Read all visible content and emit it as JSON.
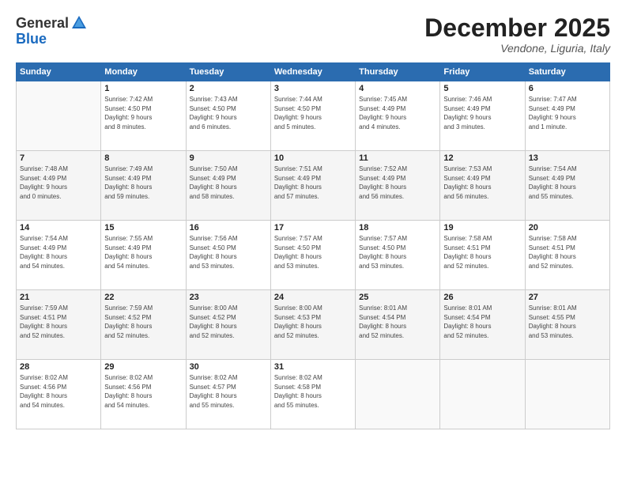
{
  "header": {
    "logo_general": "General",
    "logo_blue": "Blue",
    "month_title": "December 2025",
    "location": "Vendone, Liguria, Italy"
  },
  "weekdays": [
    "Sunday",
    "Monday",
    "Tuesday",
    "Wednesday",
    "Thursday",
    "Friday",
    "Saturday"
  ],
  "rows": [
    [
      {
        "day": "",
        "info": ""
      },
      {
        "day": "1",
        "info": "Sunrise: 7:42 AM\nSunset: 4:50 PM\nDaylight: 9 hours\nand 8 minutes."
      },
      {
        "day": "2",
        "info": "Sunrise: 7:43 AM\nSunset: 4:50 PM\nDaylight: 9 hours\nand 6 minutes."
      },
      {
        "day": "3",
        "info": "Sunrise: 7:44 AM\nSunset: 4:50 PM\nDaylight: 9 hours\nand 5 minutes."
      },
      {
        "day": "4",
        "info": "Sunrise: 7:45 AM\nSunset: 4:49 PM\nDaylight: 9 hours\nand 4 minutes."
      },
      {
        "day": "5",
        "info": "Sunrise: 7:46 AM\nSunset: 4:49 PM\nDaylight: 9 hours\nand 3 minutes."
      },
      {
        "day": "6",
        "info": "Sunrise: 7:47 AM\nSunset: 4:49 PM\nDaylight: 9 hours\nand 1 minute."
      }
    ],
    [
      {
        "day": "7",
        "info": "Sunrise: 7:48 AM\nSunset: 4:49 PM\nDaylight: 9 hours\nand 0 minutes."
      },
      {
        "day": "8",
        "info": "Sunrise: 7:49 AM\nSunset: 4:49 PM\nDaylight: 8 hours\nand 59 minutes."
      },
      {
        "day": "9",
        "info": "Sunrise: 7:50 AM\nSunset: 4:49 PM\nDaylight: 8 hours\nand 58 minutes."
      },
      {
        "day": "10",
        "info": "Sunrise: 7:51 AM\nSunset: 4:49 PM\nDaylight: 8 hours\nand 57 minutes."
      },
      {
        "day": "11",
        "info": "Sunrise: 7:52 AM\nSunset: 4:49 PM\nDaylight: 8 hours\nand 56 minutes."
      },
      {
        "day": "12",
        "info": "Sunrise: 7:53 AM\nSunset: 4:49 PM\nDaylight: 8 hours\nand 56 minutes."
      },
      {
        "day": "13",
        "info": "Sunrise: 7:54 AM\nSunset: 4:49 PM\nDaylight: 8 hours\nand 55 minutes."
      }
    ],
    [
      {
        "day": "14",
        "info": "Sunrise: 7:54 AM\nSunset: 4:49 PM\nDaylight: 8 hours\nand 54 minutes."
      },
      {
        "day": "15",
        "info": "Sunrise: 7:55 AM\nSunset: 4:49 PM\nDaylight: 8 hours\nand 54 minutes."
      },
      {
        "day": "16",
        "info": "Sunrise: 7:56 AM\nSunset: 4:50 PM\nDaylight: 8 hours\nand 53 minutes."
      },
      {
        "day": "17",
        "info": "Sunrise: 7:57 AM\nSunset: 4:50 PM\nDaylight: 8 hours\nand 53 minutes."
      },
      {
        "day": "18",
        "info": "Sunrise: 7:57 AM\nSunset: 4:50 PM\nDaylight: 8 hours\nand 53 minutes."
      },
      {
        "day": "19",
        "info": "Sunrise: 7:58 AM\nSunset: 4:51 PM\nDaylight: 8 hours\nand 52 minutes."
      },
      {
        "day": "20",
        "info": "Sunrise: 7:58 AM\nSunset: 4:51 PM\nDaylight: 8 hours\nand 52 minutes."
      }
    ],
    [
      {
        "day": "21",
        "info": "Sunrise: 7:59 AM\nSunset: 4:51 PM\nDaylight: 8 hours\nand 52 minutes."
      },
      {
        "day": "22",
        "info": "Sunrise: 7:59 AM\nSunset: 4:52 PM\nDaylight: 8 hours\nand 52 minutes."
      },
      {
        "day": "23",
        "info": "Sunrise: 8:00 AM\nSunset: 4:52 PM\nDaylight: 8 hours\nand 52 minutes."
      },
      {
        "day": "24",
        "info": "Sunrise: 8:00 AM\nSunset: 4:53 PM\nDaylight: 8 hours\nand 52 minutes."
      },
      {
        "day": "25",
        "info": "Sunrise: 8:01 AM\nSunset: 4:54 PM\nDaylight: 8 hours\nand 52 minutes."
      },
      {
        "day": "26",
        "info": "Sunrise: 8:01 AM\nSunset: 4:54 PM\nDaylight: 8 hours\nand 52 minutes."
      },
      {
        "day": "27",
        "info": "Sunrise: 8:01 AM\nSunset: 4:55 PM\nDaylight: 8 hours\nand 53 minutes."
      }
    ],
    [
      {
        "day": "28",
        "info": "Sunrise: 8:02 AM\nSunset: 4:56 PM\nDaylight: 8 hours\nand 54 minutes."
      },
      {
        "day": "29",
        "info": "Sunrise: 8:02 AM\nSunset: 4:56 PM\nDaylight: 8 hours\nand 54 minutes."
      },
      {
        "day": "30",
        "info": "Sunrise: 8:02 AM\nSunset: 4:57 PM\nDaylight: 8 hours\nand 55 minutes."
      },
      {
        "day": "31",
        "info": "Sunrise: 8:02 AM\nSunset: 4:58 PM\nDaylight: 8 hours\nand 55 minutes."
      },
      {
        "day": "",
        "info": ""
      },
      {
        "day": "",
        "info": ""
      },
      {
        "day": "",
        "info": ""
      }
    ]
  ]
}
